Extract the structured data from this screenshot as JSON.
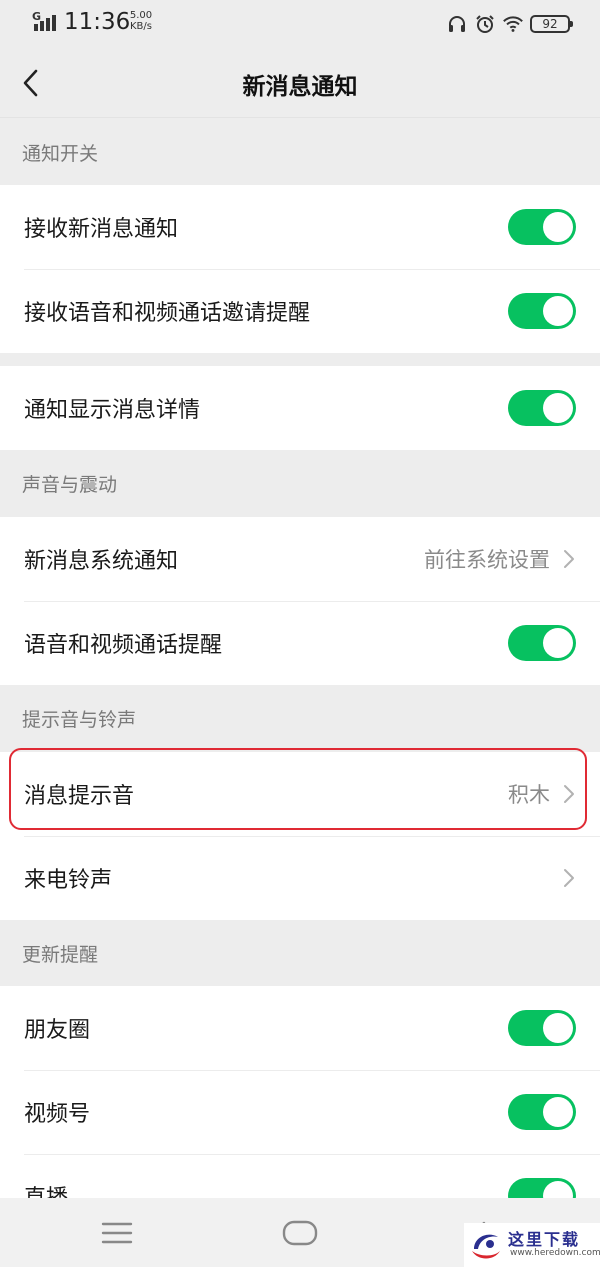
{
  "status": {
    "network": "G",
    "time": "11:36",
    "speed_value": "5.00",
    "speed_unit": "KB/s",
    "battery": "92",
    "icons": [
      "headset-icon",
      "alarm-icon",
      "wifi-icon",
      "battery-icon"
    ]
  },
  "header": {
    "title": "新消息通知",
    "back_icon": "chevron-left-icon"
  },
  "sections": {
    "notify_switch": "通知开关",
    "sound_vibration": "声音与震动",
    "tones": "提示音与铃声",
    "updates": "更新提醒"
  },
  "rows": {
    "receive_new_msg": {
      "label": "接收新消息通知",
      "on": true
    },
    "receive_call_invite": {
      "label": "接收语音和视频通话邀请提醒",
      "on": true
    },
    "show_details": {
      "label": "通知显示消息详情",
      "on": true
    },
    "system_notify": {
      "label": "新消息系统通知",
      "value": "前往系统设置"
    },
    "call_reminder": {
      "label": "语音和视频通话提醒",
      "on": true
    },
    "msg_tone": {
      "label": "消息提示音",
      "value": "积木"
    },
    "ringtone": {
      "label": "来电铃声"
    },
    "moments": {
      "label": "朋友圈",
      "on": true
    },
    "channels": {
      "label": "视频号",
      "on": true
    },
    "live": {
      "label": "直播",
      "on": true
    }
  },
  "colors": {
    "switch_on": "#07c160",
    "highlight": "#e02a34",
    "background": "#ededed"
  },
  "watermark": {
    "title": "这里下载",
    "url": "www.heredown.com"
  }
}
